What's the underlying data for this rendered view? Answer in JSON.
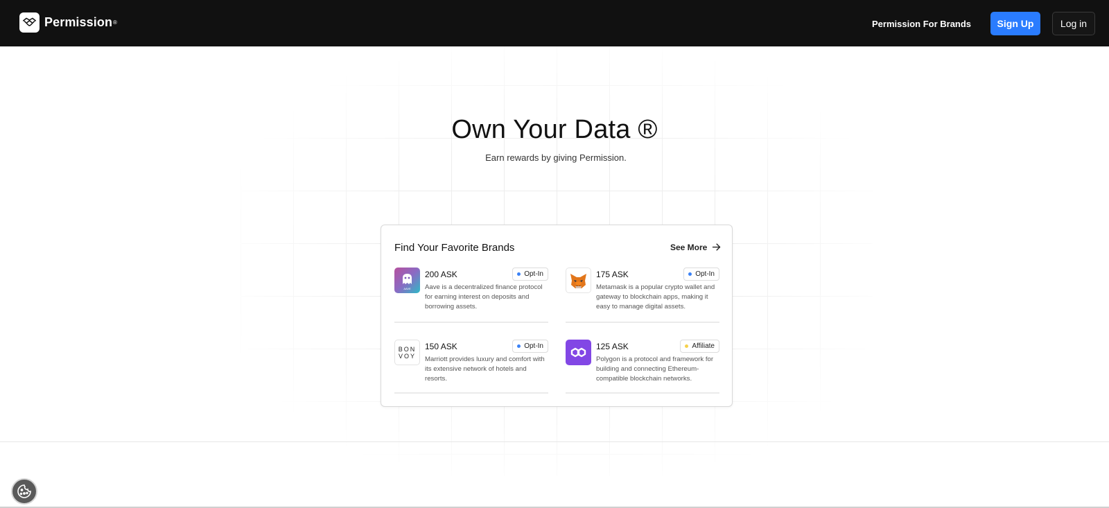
{
  "header": {
    "brand": "Permission",
    "brand_mark": "®",
    "nav_link": "Permission For Brands",
    "signup_label": "Sign Up",
    "login_label": "Log in"
  },
  "hero": {
    "title": "Own Your Data ®",
    "subtitle": "Earn rewards by giving Permission."
  },
  "card": {
    "title": "Find Your Favorite Brands",
    "see_more": "See More",
    "brands": [
      {
        "ask": "200 ASK",
        "badge": "Opt-In",
        "badge_dot": "#3b82f6",
        "logo": "aave-ghost-icon",
        "logo_text": "AAVE",
        "description": "Aave is a decentralized finance protocol for earning interest on deposits and borrowing assets."
      },
      {
        "ask": "175 ASK",
        "badge": "Opt-In",
        "badge_dot": "#3b82f6",
        "logo": "metamask-fox-icon",
        "description": "Metamask is a popular crypto wallet and gateway to blockchain apps, making it easy to manage digital assets."
      },
      {
        "ask": "150 ASK",
        "badge": "Opt-In",
        "badge_dot": "#3b82f6",
        "logo": "bonvoy-wordmark-icon",
        "logo_line1": "BON",
        "logo_line2": "VOY",
        "description": "Marriott provides luxury and comfort with its extensive network of hotels and resorts."
      },
      {
        "ask": "125 ASK",
        "badge": "Affiliate",
        "badge_dot": "#f6d14b",
        "logo": "polygon-icon",
        "description": "Polygon is a protocol and framework for building and connecting Ethereum-compatible blockchain networks."
      }
    ]
  },
  "colors": {
    "header_bg": "#111111",
    "accent": "#2a7cff",
    "aave_gradient": [
      "#b6509e",
      "#2ebac6"
    ],
    "polygon": "#8247e5",
    "metamask": "#e2761b"
  },
  "icons": {
    "logo": "permission-handshake-icon",
    "arrow": "arrow-right-icon",
    "cookie": "cookie-icon"
  }
}
